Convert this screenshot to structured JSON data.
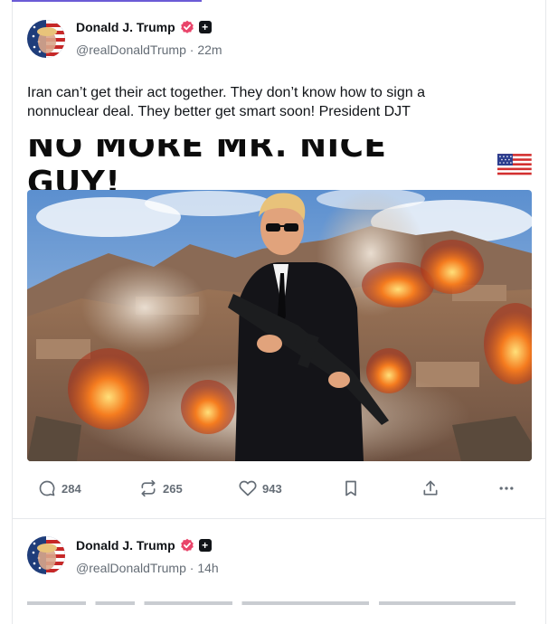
{
  "posts": [
    {
      "author_name": "Donald J. Trump",
      "handle": "@realDonaldTrump",
      "time_sep": "·",
      "time": "22m",
      "text": "Iran can’t get their act together. They don’t know how to sign a nonnuclear deal. They better get smart soon! President DJT",
      "media": {
        "banner_text": "NO MORE MR. NICE GUY!",
        "banner_emoji": "us-flag"
      },
      "actions": {
        "replies": "284",
        "retruths": "265",
        "likes": "943"
      }
    },
    {
      "author_name": "Donald J. Trump",
      "handle": "@realDonaldTrump",
      "time_sep": "·",
      "time": "14h"
    }
  ],
  "icons": {
    "verified": "verified-badge-icon",
    "plus": "plus-badge-icon",
    "reply": "reply-icon",
    "retruth": "retruth-icon",
    "like": "heart-icon",
    "bookmark": "bookmark-icon",
    "share": "share-icon",
    "more": "more-icon"
  },
  "colors": {
    "verified": "#e9446a",
    "muted_text": "#656d76",
    "accent_bar": "#6b5bd6",
    "border": "#e6e8eb"
  }
}
